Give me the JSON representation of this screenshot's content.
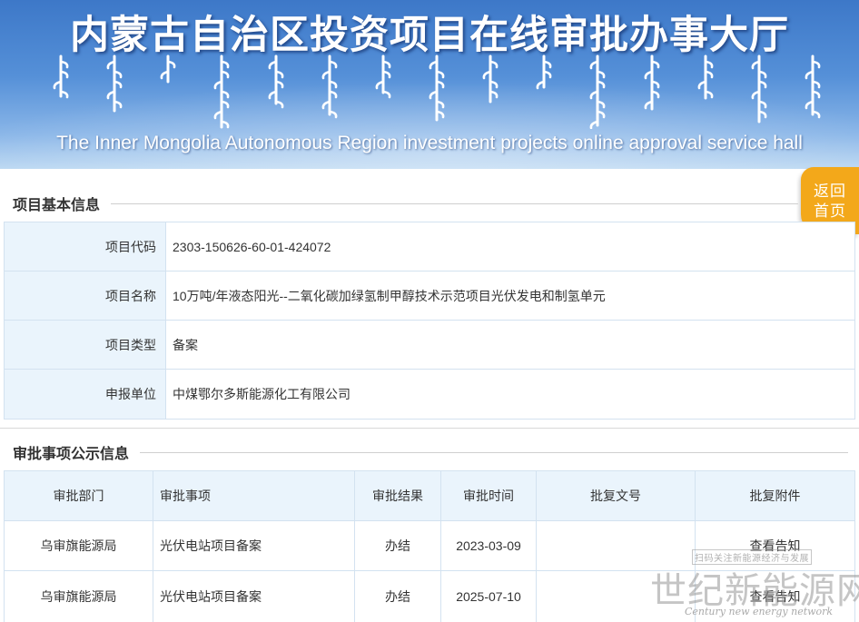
{
  "banner": {
    "title_cn": "内蒙古自治区投资项目在线审批办事大厅",
    "title_en": "The Inner Mongolia Autonomous Region investment projects online approval service hall"
  },
  "back_home": {
    "line1": "返回",
    "line2": "首页",
    "color": "#f3a81a"
  },
  "basic_info": {
    "section_title": "项目基本信息",
    "rows": [
      {
        "label": "项目代码",
        "value": "2303-150626-60-01-424072"
      },
      {
        "label": "项目名称",
        "value": "10万吨/年液态阳光--二氧化碳加绿氢制甲醇技术示范项目光伏发电和制氢单元"
      },
      {
        "label": "项目类型",
        "value": "备案"
      },
      {
        "label": "申报单位",
        "value": "中煤鄂尔多斯能源化工有限公司"
      }
    ]
  },
  "approval": {
    "section_title": "审批事项公示信息",
    "headers": [
      "审批部门",
      "审批事项",
      "审批结果",
      "审批时间",
      "批复文号",
      "批复附件"
    ],
    "rows": [
      {
        "dept": "乌审旗能源局",
        "item": "光伏电站项目备案",
        "result": "办结",
        "date": "2023-03-09",
        "doc_no": "",
        "attachment": "查看告知"
      },
      {
        "dept": "乌审旗能源局",
        "item": "光伏电站项目备案",
        "result": "办结",
        "date": "2025-07-10",
        "doc_no": "",
        "attachment": "查看告知"
      }
    ]
  },
  "watermark": {
    "small": "扫码关注新能源经济与发展",
    "big": "世纪新能源网",
    "en": "Century new energy network"
  },
  "colors": {
    "header_cell_bg": "#eaf4fc",
    "border": "#d3e2f0",
    "banner_blue": "#3d78c8"
  }
}
